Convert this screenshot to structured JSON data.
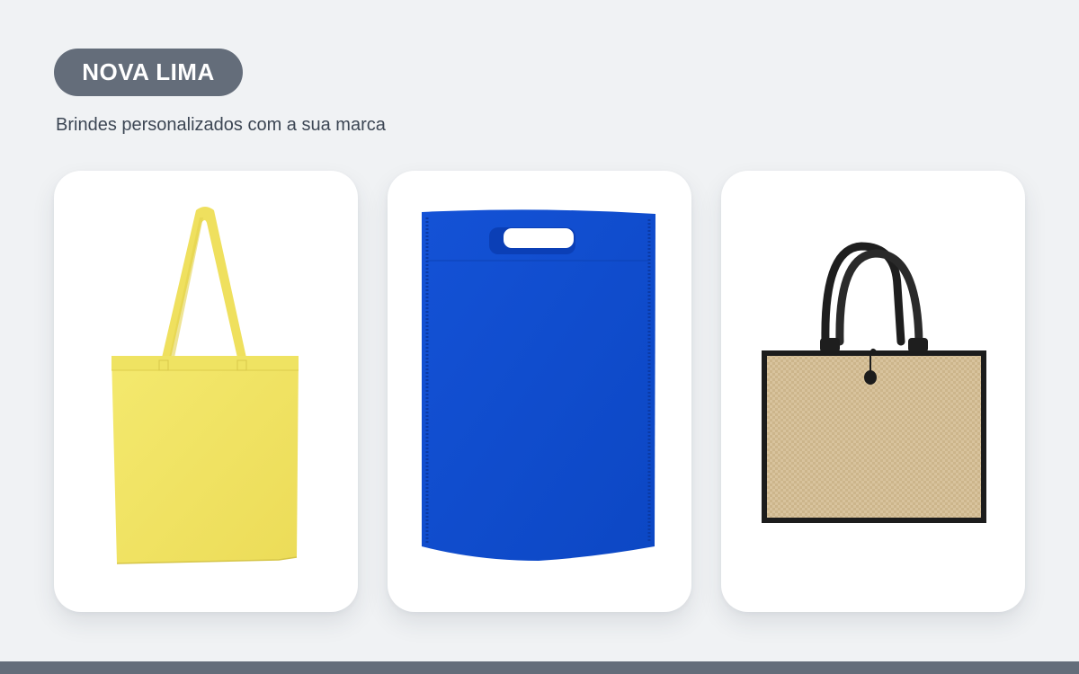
{
  "header": {
    "badge_label": "NOVA LIMA",
    "subtitle": "Brindes personalizados com a sua marca"
  },
  "products": [
    {
      "name": "yellow-tote-bag",
      "color": "#f2e566"
    },
    {
      "name": "blue-die-cut-bag",
      "color": "#0f4fd0"
    },
    {
      "name": "jute-tote-bag",
      "color": "#d9c29b"
    }
  ],
  "colors": {
    "background": "#f0f2f4",
    "badge": "#646d7a",
    "subtitle_text": "#3c4654",
    "card": "#ffffff",
    "footer_bar": "#646d7a"
  }
}
